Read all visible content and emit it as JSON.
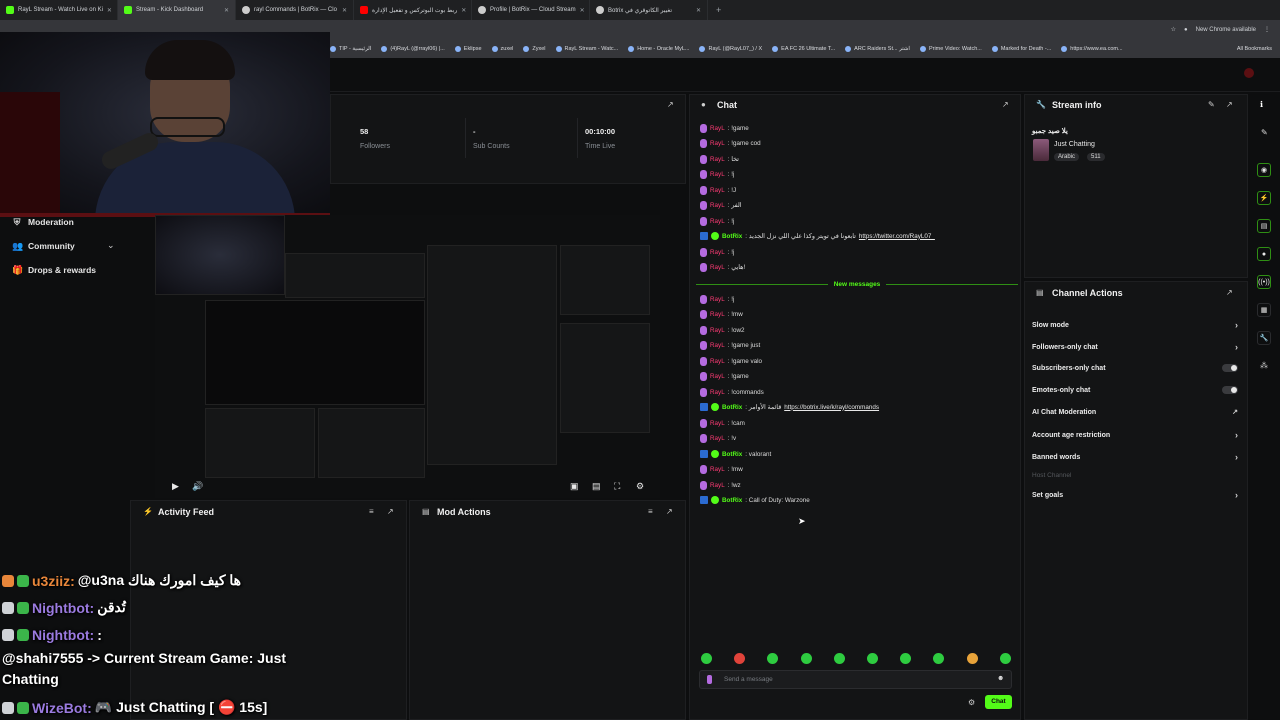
{
  "browser": {
    "tabs": [
      {
        "label": "RayL Stream - Watch Live on Ki",
        "fav": "kick-icon",
        "color": "#53fc18"
      },
      {
        "label": "Stream - Kick Dashboard",
        "fav": "kick-icon",
        "color": "#53fc18"
      },
      {
        "label": "rayl Commands | BotRix — Clo",
        "fav": "botrix-icon",
        "color": "#cccccc"
      },
      {
        "label": "ربط بوت البوتركس و تفعيل الإدارة",
        "fav": "youtube-icon",
        "color": "#ff0000"
      },
      {
        "label": "Profile | BotRix — Cloud Stream",
        "fav": "botrix-icon",
        "color": "#cccccc"
      },
      {
        "label": "Botrix تغيير الكاتوقري في",
        "fav": "page-icon",
        "color": "#cccccc"
      }
    ],
    "new_tab": "+",
    "new_chrome": "New Chrome available",
    "url": "dashboard.kick.com/stream",
    "bookmarks": [
      "TIP - الرئيسية",
      "(4)RayL (@rrayl06) |...",
      "Eklipse",
      "zuxel",
      "Zyxel",
      "RayL Stream - Watc...",
      "Home - Oracle MyL...",
      "RayL (@RayL07_) / X",
      "EA FC 26 Ultimate T...",
      "ARC Raiders St... اشتر",
      "Prime Video: Watch...",
      "Marked for Death -...",
      "https://www.ea.com..."
    ],
    "all_bookmarks": "All Bookmarks"
  },
  "nav": {
    "moderation": "Moderation",
    "community": "Community",
    "drops": "Drops & rewards"
  },
  "stats": [
    {
      "value": "58",
      "label": "Followers"
    },
    {
      "value": "-",
      "label": "Sub Counts"
    },
    {
      "value": "00:10:00",
      "label": "Time Live"
    }
  ],
  "panels": {
    "activity": "Activity Feed",
    "mod": "Mod Actions",
    "chat": "Chat",
    "stream_info": "Stream info",
    "channel_actions": "Channel Actions"
  },
  "stream_info": {
    "title": "يلا صيد جمبو",
    "category": "Just Chatting",
    "language": "Arabic",
    "viewers": "511"
  },
  "chat": {
    "lines": [
      {
        "type": "user",
        "user": "RayL",
        "text": ": !game"
      },
      {
        "type": "user",
        "user": "RayL",
        "text": ": !game cod"
      },
      {
        "type": "user",
        "user": "RayL",
        "text": ": تخا"
      },
      {
        "type": "user",
        "user": "RayL",
        "text": ": !j"
      },
      {
        "type": "user",
        "user": "RayL",
        "text": ": !J"
      },
      {
        "type": "user",
        "user": "RayL",
        "text": ": الفر"
      },
      {
        "type": "user",
        "user": "RayL",
        "text": ": !j"
      },
      {
        "type": "bot",
        "user": "BotRix",
        "text": ": تابعونا في تويتر وكذا علي اللي نزل الجديد",
        "link": "https://twitter.com/RayL07_"
      },
      {
        "type": "user",
        "user": "RayL",
        "text": ": !j"
      },
      {
        "type": "user",
        "user": "RayL",
        "text": ": هايي!"
      },
      {
        "type": "user",
        "user": "RayL",
        "text": ": !j"
      },
      {
        "type": "user",
        "user": "RayL",
        "text": ": !mw"
      },
      {
        "type": "user",
        "user": "RayL",
        "text": ": !ow2"
      },
      {
        "type": "user",
        "user": "RayL",
        "text": ": !game just"
      },
      {
        "type": "user",
        "user": "RayL",
        "text": ": !game valo"
      },
      {
        "type": "user",
        "user": "RayL",
        "text": ": !game"
      },
      {
        "type": "user",
        "user": "RayL",
        "text": ": !commands"
      },
      {
        "type": "bot",
        "user": "BotRix",
        "text": ": قائمة الأوامر",
        "link": "https://botrix.live/k/rayl/commands"
      },
      {
        "type": "user",
        "user": "RayL",
        "text": ": !cam"
      },
      {
        "type": "user",
        "user": "RayL",
        "text": ": !v"
      },
      {
        "type": "bot",
        "user": "BotRix",
        "text": ": valorant",
        "link": ""
      },
      {
        "type": "user",
        "user": "RayL",
        "text": ": !mw"
      },
      {
        "type": "user",
        "user": "RayL",
        "text": ": !wz"
      },
      {
        "type": "bot",
        "user": "BotRix",
        "text": ": Call of Duty: Warzone",
        "link": ""
      }
    ],
    "new_messages": "New messages",
    "placeholder": "Send a message",
    "send_label": "Chat"
  },
  "channel_actions": [
    {
      "label": "Slow mode",
      "control": "chevron"
    },
    {
      "label": "Followers-only chat",
      "control": "chevron"
    },
    {
      "label": "Subscribers-only chat",
      "control": "toggle"
    },
    {
      "label": "Emotes-only chat",
      "control": "toggle"
    },
    {
      "label": "AI Chat Moderation",
      "control": "external"
    },
    {
      "label": "Account age restriction",
      "control": "chevron"
    },
    {
      "label": "Banned words",
      "control": "chevron"
    },
    {
      "label": "Host Channel",
      "control": "disabled"
    },
    {
      "label": "Set goals",
      "control": "chevron"
    }
  ],
  "overlay_chat": [
    {
      "user": "u3ziiz",
      "text": "@u3na ها كيف امورك هناك",
      "color": "#e8863a"
    },
    {
      "user": "Nightbot",
      "text": "تُدقن",
      "color": "#9b7be0"
    },
    {
      "user": "Nightbot",
      "text": ":",
      "color": "#9b7be0"
    },
    {
      "user": "",
      "text": "@shahi7555 -> Current Stream Game: Just",
      "color": "#ffffff"
    },
    {
      "user": "",
      "text": "Chatting",
      "color": "#ffffff"
    },
    {
      "user": "WizeBot",
      "text": "🎮 Just Chatting [ ⛔ 15s]",
      "color": "#9b7be0"
    }
  ],
  "colors": {
    "accent": "#53fc18",
    "username": "#ff3b75",
    "live_border": "#5b0f12"
  }
}
